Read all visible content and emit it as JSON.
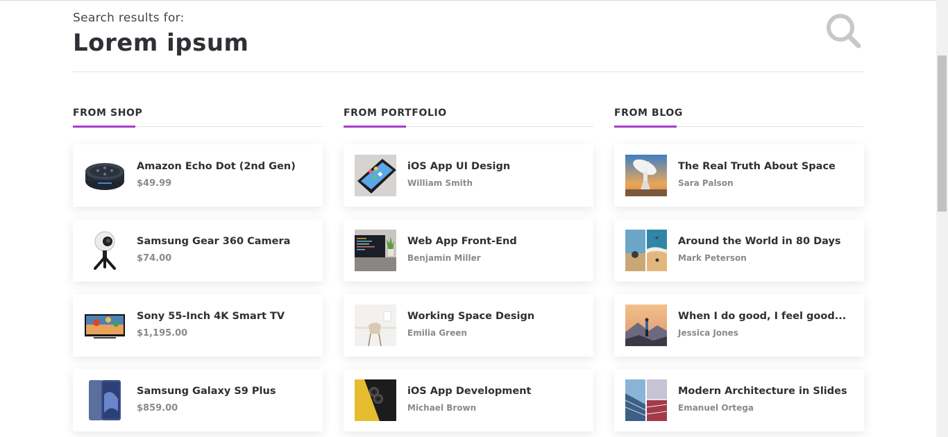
{
  "search": {
    "label": "Search results for:",
    "term": "Lorem ipsum",
    "icon": "search-icon"
  },
  "colors": {
    "accent": "#a53cc8",
    "heading": "#2f2f35",
    "muted": "#8a8a8a"
  },
  "shop": {
    "title": "FROM SHOP",
    "items": [
      {
        "title": "Amazon Echo Dot (2nd Gen)",
        "price": "$49.99",
        "icon": "echo-dot-image"
      },
      {
        "title": "Samsung Gear 360 Camera",
        "price": "$74.00",
        "icon": "gear-360-camera-image"
      },
      {
        "title": "Sony 55-Inch 4K Smart TV",
        "price": "$1,195.00",
        "icon": "smart-tv-image"
      },
      {
        "title": "Samsung Galaxy S9 Plus",
        "price": "$859.00",
        "icon": "smartphone-image"
      }
    ]
  },
  "portfolio": {
    "title": "FROM PORTFOLIO",
    "items": [
      {
        "title": "iOS App UI Design",
        "author": "William Smith"
      },
      {
        "title": "Web App Front-End",
        "author": "Benjamin Miller"
      },
      {
        "title": "Working Space Design",
        "author": "Emilia Green"
      },
      {
        "title": "iOS App Development",
        "author": "Michael Brown"
      }
    ]
  },
  "blog": {
    "title": "FROM BLOG",
    "items": [
      {
        "title": "The Real Truth About Space",
        "author": "Sara Palson"
      },
      {
        "title": "Around the World in 80 Days",
        "author": "Mark Peterson"
      },
      {
        "title": "When I do good, I feel good...",
        "author": "Jessica Jones"
      },
      {
        "title": "Modern Architecture in Slides",
        "author": "Emanuel Ortega"
      }
    ]
  }
}
